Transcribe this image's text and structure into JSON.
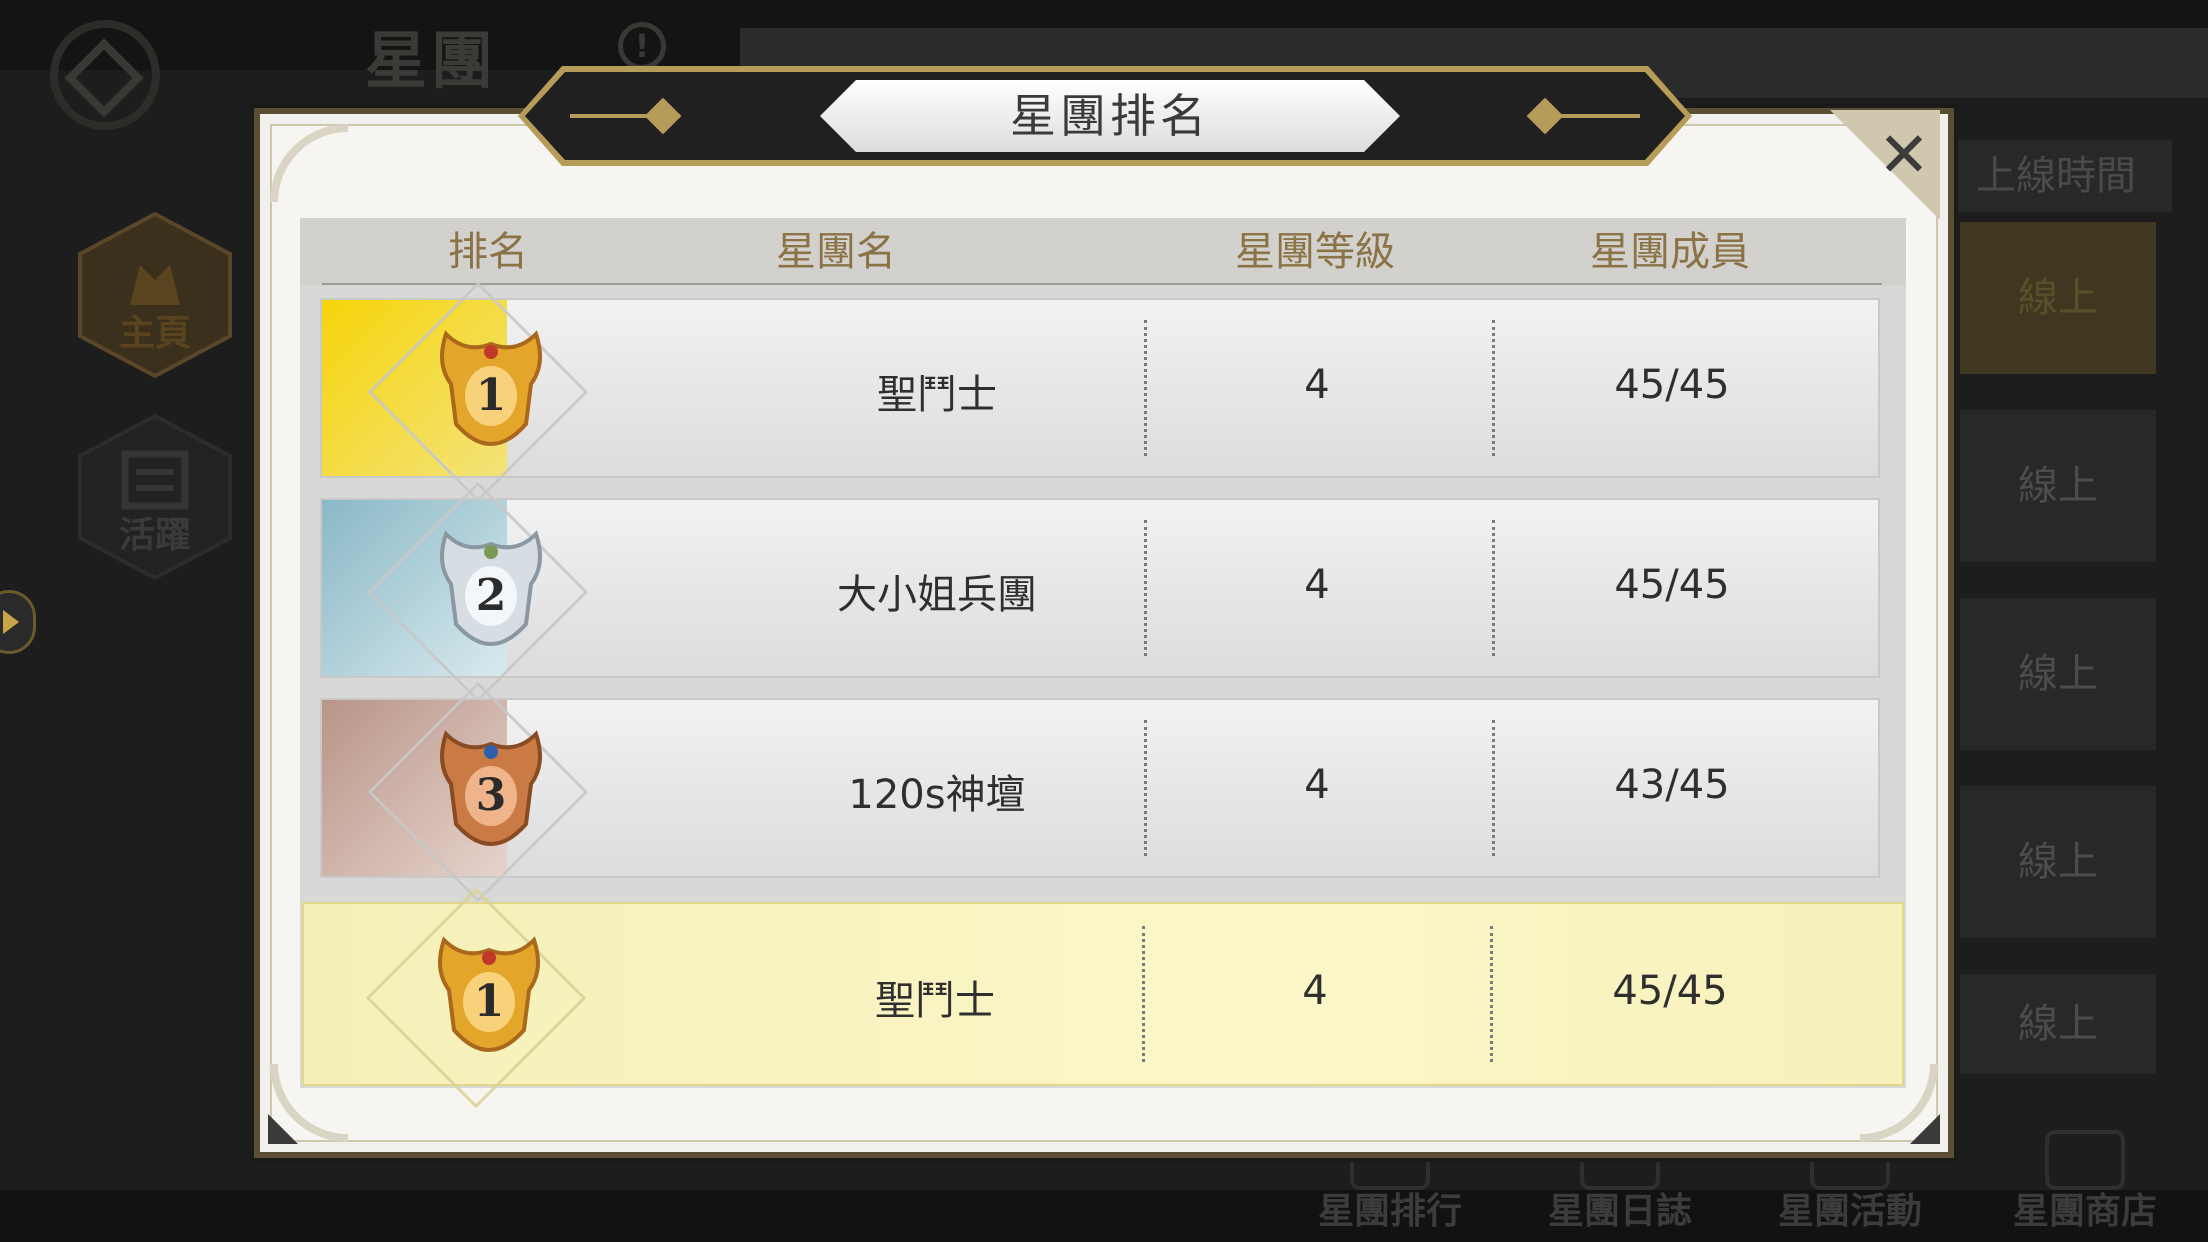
{
  "screen": {
    "title": "星團",
    "sidebar": [
      {
        "label": "主頁",
        "icon": "castle-icon"
      },
      {
        "label": "活躍",
        "icon": "clipboard-icon"
      }
    ],
    "right_panel": {
      "header": "上線時間",
      "rows": [
        "線上",
        "線上",
        "線上",
        "線上",
        "線上"
      ]
    },
    "bottom_nav": [
      {
        "label": "星團排行",
        "icon": "trophy-icon"
      },
      {
        "label": "星團日誌",
        "icon": "book-icon"
      },
      {
        "label": "星團活動",
        "icon": "flag-icon"
      },
      {
        "label": "星團商店",
        "icon": "shop-icon"
      }
    ]
  },
  "modal": {
    "title": "星團排名",
    "close_icon": "close-icon",
    "columns": [
      "排名",
      "星團名",
      "星團等級",
      "星團成員"
    ],
    "rows": [
      {
        "rank": "1",
        "name": "聖鬥士",
        "level": "4",
        "members": "45/45",
        "medal": "gold",
        "swatch": "#f3d61a"
      },
      {
        "rank": "2",
        "name": "大小姐兵團",
        "level": "4",
        "members": "45/45",
        "medal": "silver",
        "swatch": "#9ec8d3"
      },
      {
        "rank": "3",
        "name": "120s神壇",
        "level": "4",
        "members": "43/45",
        "medal": "bronze",
        "swatch": "#c7a599"
      }
    ],
    "own_row": {
      "rank": "1",
      "name": "聖鬥士",
      "level": "4",
      "members": "45/45",
      "medal": "gold"
    }
  }
}
